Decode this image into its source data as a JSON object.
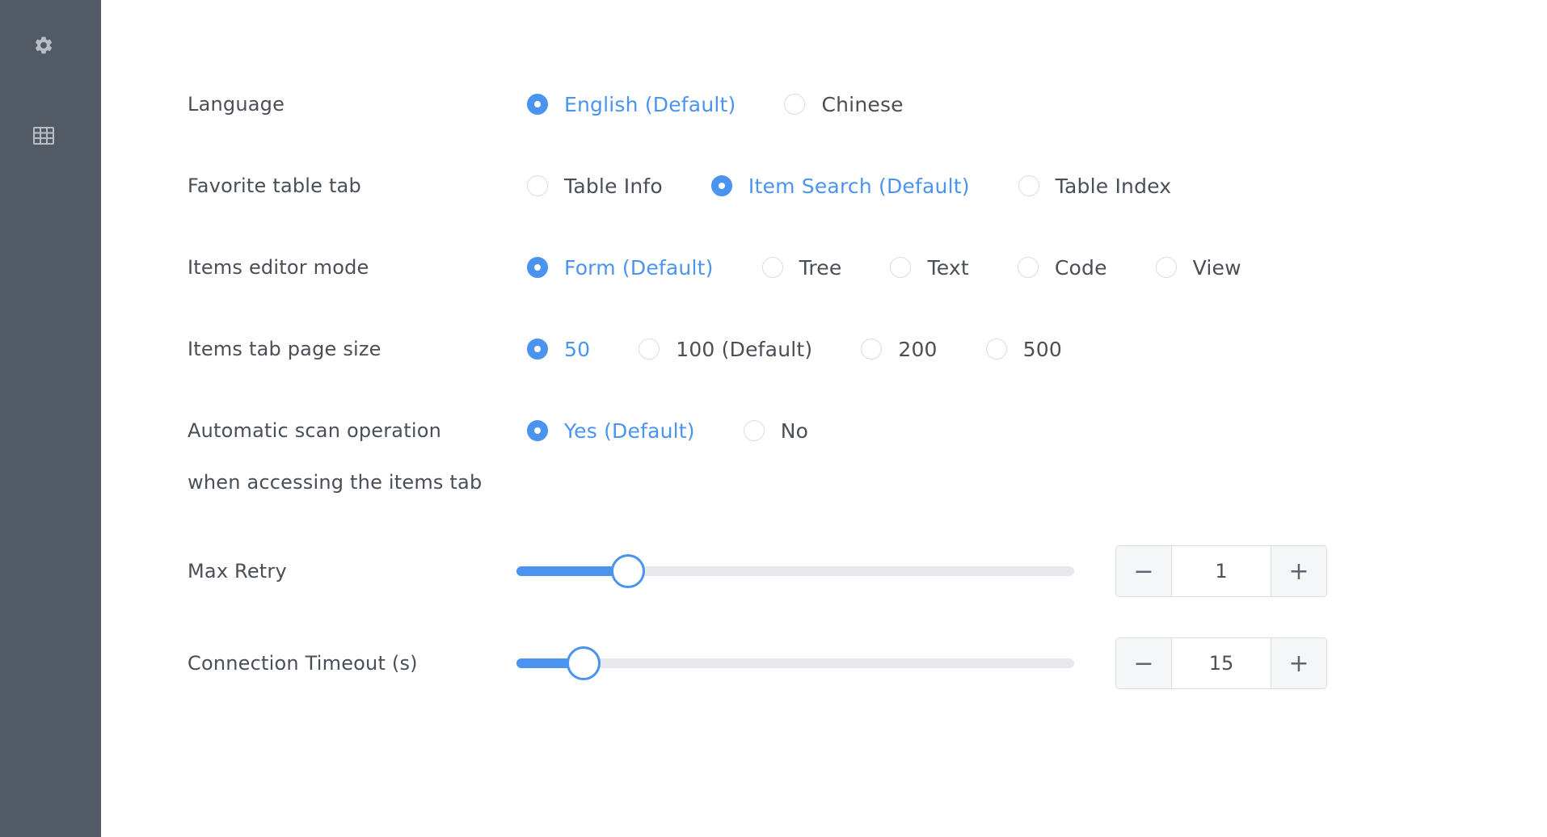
{
  "sidebar": {
    "items": [
      {
        "icon": "gear-icon"
      },
      {
        "icon": "table-icon"
      }
    ],
    "icon_color": "#b8bdc4"
  },
  "settings": {
    "language": {
      "label": "Language",
      "options": [
        "English (Default)",
        "Chinese"
      ],
      "selected": "English (Default)"
    },
    "favorite_tab": {
      "label": "Favorite table tab",
      "options": [
        "Table Info",
        "Item Search (Default)",
        "Table Index"
      ],
      "selected": "Item Search (Default)"
    },
    "editor_mode": {
      "label": "Items editor mode",
      "options": [
        "Form (Default)",
        "Tree",
        "Text",
        "Code",
        "View"
      ],
      "selected": "Form (Default)"
    },
    "page_size": {
      "label": "Items tab page size",
      "options": [
        "50",
        "100 (Default)",
        "200",
        "500"
      ],
      "selected": "50"
    },
    "auto_scan": {
      "label_line1": "Automatic scan operation",
      "label_line2": "when accessing the items tab",
      "options": [
        "Yes (Default)",
        "No"
      ],
      "selected": "Yes (Default)"
    },
    "max_retry": {
      "label": "Max Retry",
      "value": "1",
      "slider_fraction": 0.2
    },
    "timeout": {
      "label": "Connection Timeout (s)",
      "value": "15",
      "slider_fraction": 0.12
    }
  },
  "stepper": {
    "minus": "−",
    "plus": "+"
  },
  "colors": {
    "accent": "#4a94f0",
    "sidebar_bg": "#525a65",
    "text": "#4a4f57",
    "border": "#d9dce1"
  }
}
